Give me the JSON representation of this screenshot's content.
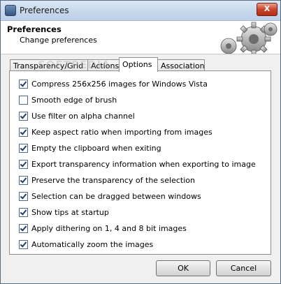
{
  "window": {
    "title": "Preferences",
    "close_glyph": "X"
  },
  "header": {
    "title": "Preferences",
    "subtitle": "Change preferences",
    "watermark": "SOFTPEDIA"
  },
  "tabs": [
    {
      "label": "Transparency/Grid"
    },
    {
      "label": "Actions"
    },
    {
      "label": "Options",
      "active": true
    },
    {
      "label": "Association"
    }
  ],
  "options": [
    {
      "label": "Compress 256x256 images for Windows Vista",
      "checked": true
    },
    {
      "label": "Smooth edge of brush",
      "checked": false
    },
    {
      "label": "Use filter on alpha channel",
      "checked": true
    },
    {
      "label": "Keep aspect ratio when importing from images",
      "checked": true
    },
    {
      "label": "Empty the clipboard when exiting",
      "checked": true
    },
    {
      "label": "Export transparency information when exporting to image",
      "checked": true
    },
    {
      "label": "Preserve the transparency of the selection",
      "checked": true
    },
    {
      "label": "Selection can be dragged between windows",
      "checked": true
    },
    {
      "label": "Show tips at startup",
      "checked": true
    },
    {
      "label": "Apply dithering on 1, 4 and 8 bit images",
      "checked": true
    },
    {
      "label": "Automatically zoom the images",
      "checked": true
    }
  ],
  "buttons": {
    "ok": "OK",
    "cancel": "Cancel"
  }
}
